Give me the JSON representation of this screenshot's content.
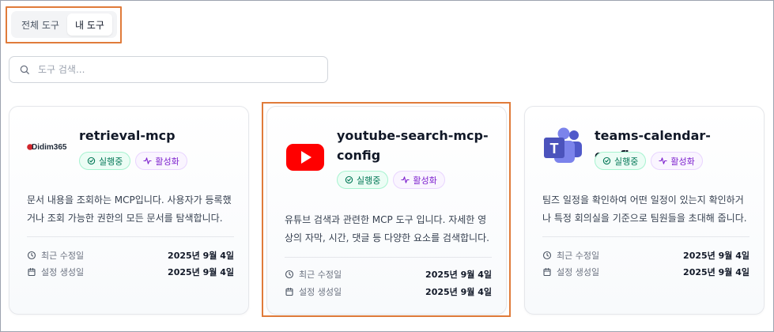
{
  "tabs": [
    {
      "label": "전체 도구",
      "active": false
    },
    {
      "label": "내 도구",
      "active": true
    }
  ],
  "search": {
    "placeholder": "도구 검색..."
  },
  "labels": {
    "running": "실행중",
    "active": "활성화",
    "modified": "최근 수정일",
    "created": "설정 생성일"
  },
  "cards": [
    {
      "title": "retrieval-mcp",
      "logo_text": "Didim365",
      "description": "문서 내용을 조회하는 MCP입니다. 사용자가 등록했거나 조회 가능한 권한의 모든 문서를 탐색합니다.",
      "modified": "2025년 9월 4일",
      "created": "2025년 9월 4일"
    },
    {
      "title": "youtube-search-mcp-config",
      "description": "유튜브 검색과 관련한 MCP 도구 입니다. 자세한 영상의 자막, 시간, 댓글 등 다양한 요소를 검색합니다.",
      "modified": "2025년 9월 4일",
      "created": "2025년 9월 4일"
    },
    {
      "title": "teams-calendar-config",
      "description": "팀즈 일정을 확인하여 어떤 일정이 있는지 확인하거나 특정 회의실을 기준으로 팀원들을 초대해 줍니다.",
      "modified": "2025년 9월 4일",
      "created": "2025년 9월 4일"
    }
  ],
  "colors": {
    "highlight": "#e07b3a",
    "youtube": "#ff0000",
    "teams": "#5059c9",
    "didim": "#d1262c"
  }
}
